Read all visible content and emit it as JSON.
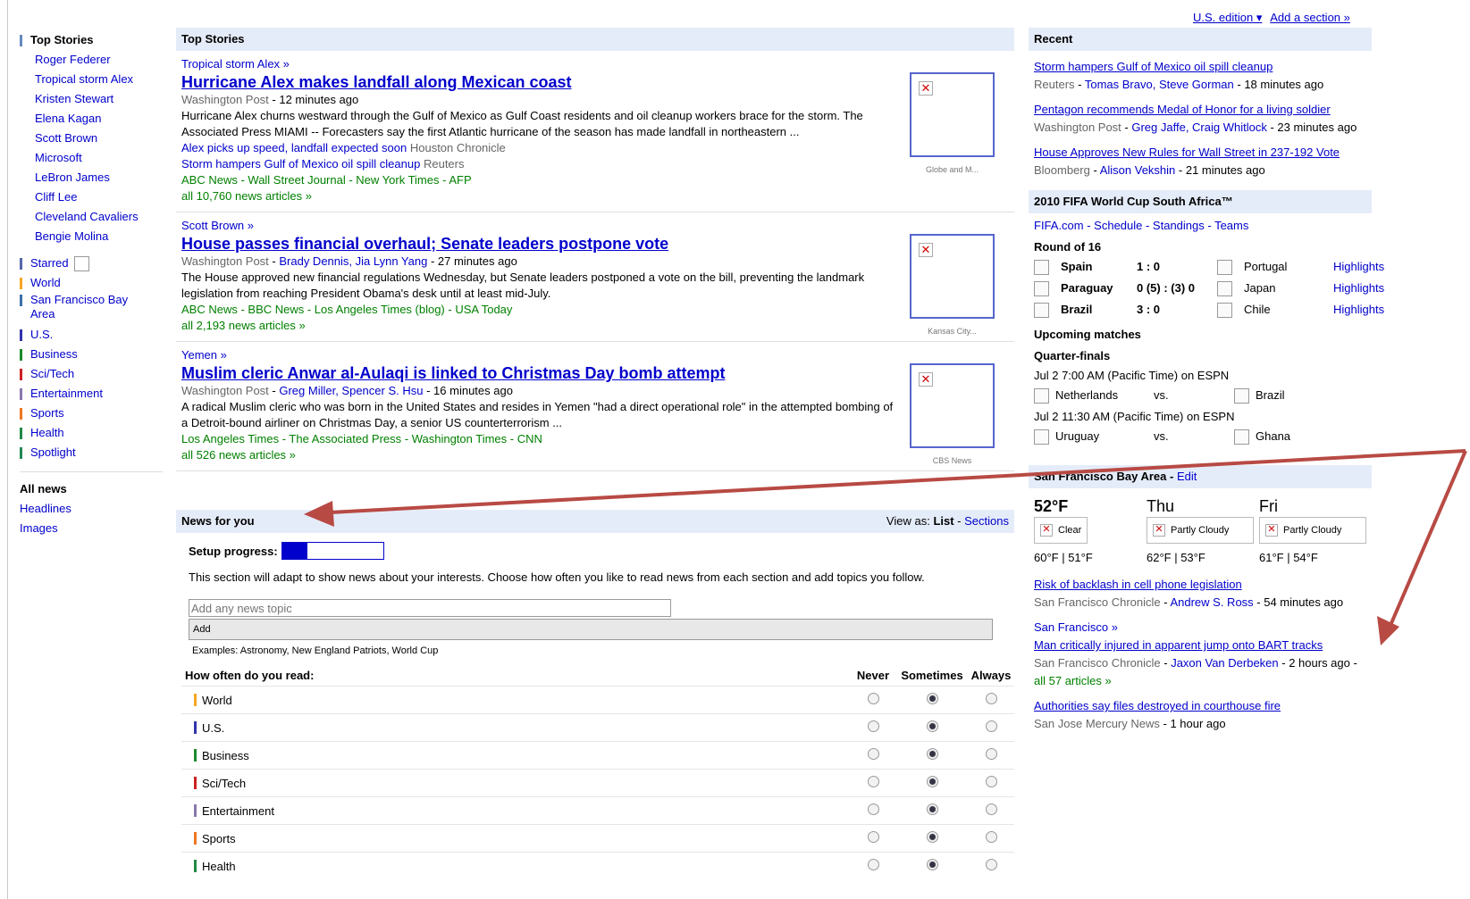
{
  "top_links": {
    "edition": "U.S. edition ▾",
    "add_section": "Add a section »"
  },
  "left_nav": {
    "top_stories_label": "Top Stories",
    "top_story_topics": [
      "Roger Federer",
      "Tropical storm Alex",
      "Kristen Stewart",
      "Elena Kagan",
      "Scott Brown",
      "Microsoft",
      "LeBron James",
      "Cliff Lee",
      "Cleveland Cavaliers",
      "Bengie Molina"
    ],
    "sections": [
      {
        "label": "Starred",
        "color": "#5566aa"
      },
      {
        "label": "World",
        "color": "#f6a623"
      },
      {
        "label": "San Francisco Bay Area",
        "color": "#3d6fa8"
      },
      {
        "label": "U.S.",
        "color": "#3333aa"
      },
      {
        "label": "Business",
        "color": "#1d8a2c"
      },
      {
        "label": "Sci/Tech",
        "color": "#cc2222"
      },
      {
        "label": "Entertainment",
        "color": "#8877aa"
      },
      {
        "label": "Sports",
        "color": "#ee7722"
      },
      {
        "label": "Health",
        "color": "#228844"
      },
      {
        "label": "Spotlight",
        "color": "#228855"
      }
    ],
    "all_news": "All news",
    "headlines": "Headlines",
    "images": "Images"
  },
  "top_stories": {
    "header": "Top Stories",
    "stories": [
      {
        "topic": "Tropical storm Alex »",
        "headline": "Hurricane Alex makes landfall along Mexican coast",
        "source": "Washington Post",
        "authors": "",
        "time": "12 minutes ago",
        "snippet": "Hurricane Alex churns westward through the Gulf of Mexico as Gulf Coast residents and oil cleanup workers brace for the storm. The Associated Press MIAMI -- Forecasters say the first Atlantic hurricane of the season has made landfall in northeastern ...",
        "related": [
          {
            "title": "Alex picks up speed, landfall expected soon",
            "source": "Houston Chronicle"
          },
          {
            "title": "Storm hampers Gulf of Mexico oil spill cleanup",
            "source": "Reuters"
          }
        ],
        "more_sources": "ABC News - Wall Street Journal - New York Times - AFP",
        "all_articles": "all 10,760 news articles »",
        "thumb_caption": "Globe and M..."
      },
      {
        "topic": "Scott Brown »",
        "headline": "House passes financial overhaul; Senate leaders postpone vote",
        "source": "Washington Post",
        "authors": "Brady Dennis, Jia Lynn Yang",
        "time": "27 minutes ago",
        "snippet": "The House approved new financial regulations Wednesday, but Senate leaders postponed a vote on the bill, preventing the landmark legislation from reaching President Obama's desk until at least mid-July.",
        "related": [],
        "more_sources": "ABC News - BBC News - Los Angeles Times (blog) - USA Today",
        "all_articles": "all 2,193 news articles »",
        "thumb_caption": "Kansas City..."
      },
      {
        "topic": "Yemen »",
        "headline": "Muslim cleric Anwar al-Aulaqi is linked to Christmas Day bomb attempt",
        "source": "Washington Post",
        "authors": "Greg Miller, Spencer S. Hsu",
        "time": "16 minutes ago",
        "snippet": "A radical Muslim cleric who was born in the United States and resides in Yemen \"had a direct operational role\" in the attempted bombing of a Detroit-bound airliner on Christmas Day, a senior US counterterrorism ...",
        "related": [],
        "more_sources": "Los Angeles Times - The Associated Press - Washington Times - CNN",
        "all_articles": "all 526 news articles »",
        "thumb_caption": "CBS News"
      }
    ]
  },
  "news_for_you": {
    "header": "News for you",
    "view_as_label": "View as:",
    "view_list": "List",
    "view_sections": "Sections",
    "setup_progress_label": "Setup progress:",
    "setup_progress_fraction": 0.25,
    "description": "This section will adapt to show news about your interests. Choose how often you like to read news from each section and add topics you follow.",
    "input_placeholder": "Add any news topic",
    "add_button": "Add",
    "examples": "Examples: Astronomy, New England Patriots, World Cup",
    "how_often_label": "How often do you read:",
    "columns": [
      "Never",
      "Sometimes",
      "Always"
    ],
    "rows": [
      {
        "label": "World",
        "color": "#f6a623",
        "selected": 1
      },
      {
        "label": "U.S.",
        "color": "#3333aa",
        "selected": 1
      },
      {
        "label": "Business",
        "color": "#1d8a2c",
        "selected": 1
      },
      {
        "label": "Sci/Tech",
        "color": "#cc2222",
        "selected": 1
      },
      {
        "label": "Entertainment",
        "color": "#8877aa",
        "selected": 1
      },
      {
        "label": "Sports",
        "color": "#ee7722",
        "selected": 1
      },
      {
        "label": "Health",
        "color": "#228844",
        "selected": 1
      }
    ]
  },
  "recent": {
    "header": "Recent",
    "items": [
      {
        "title": "Storm hampers Gulf of Mexico oil spill cleanup",
        "source": "Reuters",
        "authors": "Tomas Bravo, Steve Gorman",
        "time": "18 minutes ago"
      },
      {
        "title": "Pentagon recommends Medal of Honor for a living soldier",
        "source": "Washington Post",
        "authors": "Greg Jaffe, Craig Whitlock",
        "time": "23 minutes ago"
      },
      {
        "title": "House Approves New Rules for Wall Street in 237-192 Vote",
        "source": "Bloomberg",
        "authors": "Alison Vekshin",
        "time": "21 minutes ago"
      }
    ]
  },
  "world_cup": {
    "header": "2010 FIFA World Cup South Africa™",
    "links": "FIFA.com - Schedule - Standings - Teams",
    "round_label": "Round of 16",
    "matches": [
      {
        "home": "Spain",
        "score": "1 : 0",
        "away": "Portugal",
        "link": "Highlights"
      },
      {
        "home": "Paraguay",
        "score": "0 (5) : (3) 0",
        "away": "Japan",
        "link": "Highlights"
      },
      {
        "home": "Brazil",
        "score": "3 : 0",
        "away": "Chile",
        "link": "Highlights"
      }
    ],
    "upcoming_label": "Upcoming matches",
    "stage_label": "Quarter-finals",
    "upcoming": [
      {
        "when": "Jul 2 7:00 AM (Pacific Time) on ESPN",
        "home": "Netherlands",
        "away": "Brazil"
      },
      {
        "when": "Jul 2 11:30 AM (Pacific Time) on ESPN",
        "home": "Uruguay",
        "away": "Ghana"
      }
    ],
    "vs": "vs."
  },
  "sf_bay": {
    "header": "San Francisco Bay Area",
    "edit": "Edit",
    "weather": [
      {
        "day": "52°F",
        "cond": "Clear",
        "temps": "60°F | 51°F"
      },
      {
        "day": "Thu",
        "cond": "Partly Cloudy",
        "temps": "62°F | 53°F"
      },
      {
        "day": "Fri",
        "cond": "Partly Cloudy",
        "temps": "61°F | 54°F"
      }
    ],
    "items": [
      {
        "title": "Risk of backlash in cell phone legislation",
        "source": "San Francisco Chronicle",
        "authors": "Andrew S. Ross",
        "time": "54 minutes ago"
      },
      {
        "topic": "San Francisco »",
        "title": "Man critically injured in apparent jump onto BART tracks",
        "source": "San Francisco Chronicle",
        "authors": "Jaxon Van Derbeken",
        "time": "2 hours ago",
        "extra": "all 57 articles »"
      },
      {
        "title": "Authorities say files destroyed in courthouse fire",
        "source": "San Jose Mercury News",
        "authors": "",
        "time": "1 hour ago"
      }
    ]
  }
}
